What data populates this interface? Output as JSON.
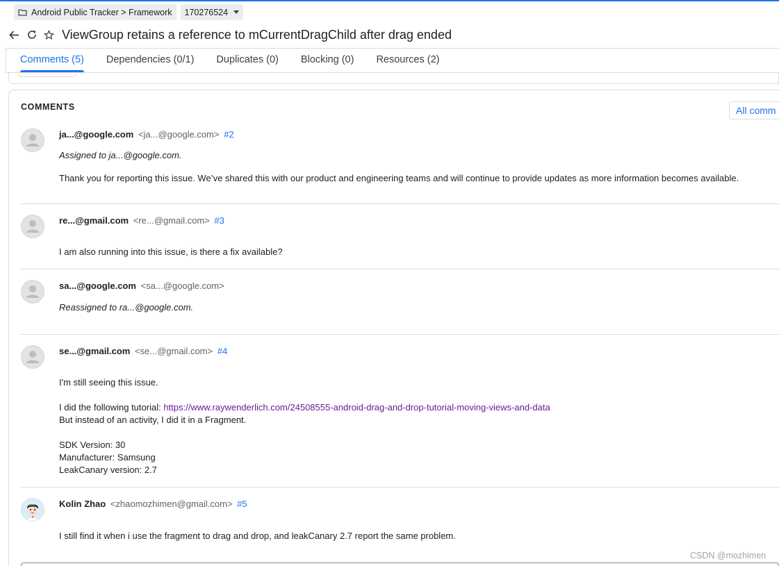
{
  "breadcrumb": {
    "project": "Android Public Tracker > Framework",
    "issue_id": "170276524"
  },
  "icons": {
    "back": "arrow-left-icon",
    "refresh": "refresh-icon",
    "star": "star-outline-icon",
    "folder": "folder-icon",
    "dropdown": "caret-down-icon"
  },
  "header": {
    "title": "ViewGroup retains a reference to mCurrentDragChild after drag ended"
  },
  "tabs": [
    {
      "label": "Comments (5)",
      "active": true
    },
    {
      "label": "Dependencies (0/1)",
      "active": false
    },
    {
      "label": "Duplicates (0)",
      "active": false
    },
    {
      "label": "Blocking (0)",
      "active": false
    },
    {
      "label": "Resources (2)",
      "active": false
    }
  ],
  "comments_panel": {
    "heading": "COMMENTS",
    "all_comments_button": "All comm",
    "items": [
      {
        "name": "ja...@google.com",
        "email": "<ja...@google.com>",
        "number": "#2",
        "lines": [
          {
            "text": "Assigned to ja...@google.com.",
            "italic": true
          },
          {
            "text": "Thank you for reporting this issue. We’ve shared this with our product and engineering teams and will continue to provide updates as more information becomes available.",
            "italic": false
          }
        ]
      },
      {
        "name": "re...@gmail.com",
        "email": "<re...@gmail.com>",
        "number": "#3",
        "lines": [
          {
            "text": "I am also running into this issue, is there a fix available?",
            "italic": false
          }
        ]
      },
      {
        "name": "sa...@google.com",
        "email": "<sa...@google.com>",
        "number": "",
        "lines": [
          {
            "text": "Reassigned to ra...@google.com.",
            "italic": true
          }
        ]
      },
      {
        "name": "se...@gmail.com",
        "email": "<se...@gmail.com>",
        "number": "#4",
        "lines": [
          {
            "text": "I'm still seeing this issue.",
            "italic": false
          },
          {
            "prefix": "I did the following tutorial: ",
            "link": "https://www.raywenderlich.com/24508555-android-drag-and-drop-tutorial-moving-views-and-data"
          },
          {
            "text": "But instead of an activity, I did it in a Fragment.",
            "italic": false
          },
          {
            "text": "SDK Version: 30",
            "italic": false
          },
          {
            "text": "Manufacturer: Samsung",
            "italic": false
          },
          {
            "text": "LeakCanary version: 2.7",
            "italic": false
          }
        ]
      },
      {
        "name": "Kolin Zhao",
        "email": "<zhaomozhimen@gmail.com>",
        "number": "#5",
        "lines": [
          {
            "text": "I still find it when i use the fragment to drag and drop, and leakCanary 2.7 report the same problem.",
            "italic": false
          }
        ]
      }
    ]
  },
  "watermark": "CSDN @mozhimen",
  "colors": {
    "accent": "#1a73e8",
    "link_visited": "#6a1b9a",
    "chip_bg": "#ebedef",
    "border": "#dadce0"
  }
}
